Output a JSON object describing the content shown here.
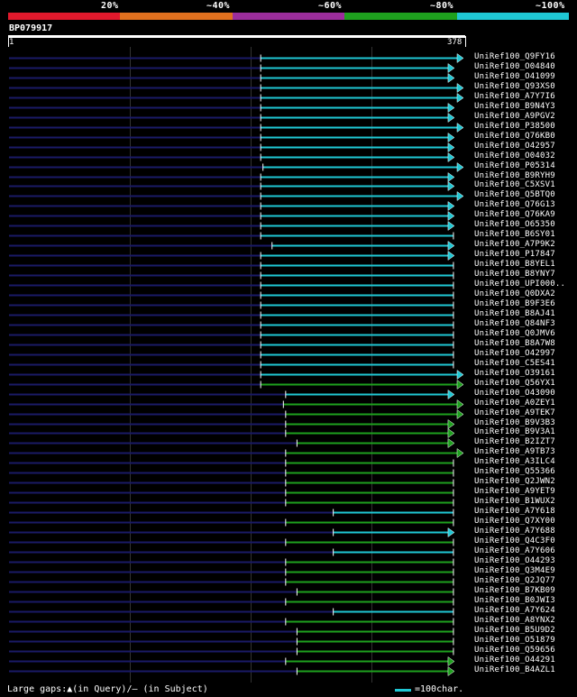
{
  "legend": {
    "labels": [
      "20%",
      "~40%",
      "~60%",
      "~80%",
      "~100%"
    ],
    "colors": [
      "#e0192c",
      "#e0701e",
      "#9b2d9b",
      "#1ea01e",
      "#1fc7d4"
    ]
  },
  "query": {
    "name": "BP079917",
    "start": "1",
    "end": "378"
  },
  "colors": {
    "cyan": "#1fc7d4",
    "green": "#1ea01e",
    "dashed": "#1a1a66",
    "background": "#000000"
  },
  "hits": [
    {
      "label": "UniRef100_Q9FY16",
      "start": 0.555,
      "end": 1.0,
      "arrow": true,
      "color": "cyan"
    },
    {
      "label": "UniRef100_O04840",
      "start": 0.555,
      "end": 0.98,
      "arrow": true,
      "color": "cyan"
    },
    {
      "label": "UniRef100_O41099",
      "start": 0.555,
      "end": 0.98,
      "arrow": true,
      "color": "cyan"
    },
    {
      "label": "UniRef100_Q93XS0",
      "start": 0.555,
      "end": 1.0,
      "arrow": true,
      "color": "cyan"
    },
    {
      "label": "UniRef100_A7Y7I6",
      "start": 0.555,
      "end": 1.0,
      "arrow": true,
      "color": "cyan"
    },
    {
      "label": "UniRef100_B9N4Y3",
      "start": 0.555,
      "end": 0.98,
      "arrow": true,
      "color": "cyan"
    },
    {
      "label": "UniRef100_A9PGV2",
      "start": 0.555,
      "end": 0.98,
      "arrow": true,
      "color": "cyan"
    },
    {
      "label": "UniRef100_P38500",
      "start": 0.555,
      "end": 1.0,
      "arrow": true,
      "color": "cyan"
    },
    {
      "label": "UniRef100_Q76KB0",
      "start": 0.555,
      "end": 0.98,
      "arrow": true,
      "color": "cyan"
    },
    {
      "label": "UniRef100_O42957",
      "start": 0.555,
      "end": 0.98,
      "arrow": true,
      "color": "cyan"
    },
    {
      "label": "UniRef100_O04032",
      "start": 0.555,
      "end": 0.98,
      "arrow": true,
      "color": "cyan"
    },
    {
      "label": "UniRef100_P05314",
      "start": 0.56,
      "end": 1.0,
      "arrow": true,
      "color": "cyan"
    },
    {
      "label": "UniRef100_B9RYH9",
      "start": 0.555,
      "end": 0.98,
      "arrow": true,
      "color": "cyan"
    },
    {
      "label": "UniRef100_C5XSV1",
      "start": 0.555,
      "end": 0.98,
      "arrow": true,
      "color": "cyan"
    },
    {
      "label": "UniRef100_Q5BTQ0",
      "start": 0.555,
      "end": 1.0,
      "arrow": true,
      "color": "cyan"
    },
    {
      "label": "UniRef100_Q76G13",
      "start": 0.555,
      "end": 0.98,
      "arrow": true,
      "color": "cyan"
    },
    {
      "label": "UniRef100_Q76KA9",
      "start": 0.555,
      "end": 0.98,
      "arrow": true,
      "color": "cyan"
    },
    {
      "label": "UniRef100_O65350",
      "start": 0.555,
      "end": 0.98,
      "arrow": true,
      "color": "cyan"
    },
    {
      "label": "UniRef100_B6SY01",
      "start": 0.555,
      "end": 0.98,
      "arrow": false,
      "color": "cyan"
    },
    {
      "label": "UniRef100_A7P9K2",
      "start": 0.58,
      "end": 0.98,
      "arrow": true,
      "color": "cyan"
    },
    {
      "label": "UniRef100_P17847",
      "start": 0.555,
      "end": 0.98,
      "arrow": true,
      "color": "cyan"
    },
    {
      "label": "UniRef100_B8YEL1",
      "start": 0.555,
      "end": 0.98,
      "arrow": false,
      "color": "cyan"
    },
    {
      "label": "UniRef100_B8YNY7",
      "start": 0.555,
      "end": 0.98,
      "arrow": false,
      "color": "cyan"
    },
    {
      "label": "UniRef100_UPI000..",
      "start": 0.555,
      "end": 0.98,
      "arrow": false,
      "color": "cyan"
    },
    {
      "label": "UniRef100_Q0DXA2",
      "start": 0.555,
      "end": 0.98,
      "arrow": false,
      "color": "cyan"
    },
    {
      "label": "UniRef100_B9F3E6",
      "start": 0.555,
      "end": 0.98,
      "arrow": false,
      "color": "cyan"
    },
    {
      "label": "UniRef100_B8AJ41",
      "start": 0.555,
      "end": 0.98,
      "arrow": false,
      "color": "cyan"
    },
    {
      "label": "UniRef100_Q84NF3",
      "start": 0.555,
      "end": 0.98,
      "arrow": false,
      "color": "cyan"
    },
    {
      "label": "UniRef100_Q0JMV6",
      "start": 0.555,
      "end": 0.98,
      "arrow": false,
      "color": "cyan"
    },
    {
      "label": "UniRef100_B8A7W8",
      "start": 0.555,
      "end": 0.98,
      "arrow": false,
      "color": "cyan"
    },
    {
      "label": "UniRef100_O42997",
      "start": 0.555,
      "end": 0.98,
      "arrow": false,
      "color": "cyan"
    },
    {
      "label": "UniRef100_C5ES41",
      "start": 0.555,
      "end": 0.98,
      "arrow": false,
      "color": "cyan"
    },
    {
      "label": "UniRef100_O39161",
      "start": 0.555,
      "end": 1.0,
      "arrow": true,
      "color": "cyan"
    },
    {
      "label": "UniRef100_Q56YX1",
      "start": 0.555,
      "end": 1.0,
      "arrow": true,
      "color": "green"
    },
    {
      "label": "UniRef100_O43090",
      "start": 0.61,
      "end": 0.98,
      "arrow": true,
      "color": "cyan"
    },
    {
      "label": "UniRef100_A0ZEY1",
      "start": 0.605,
      "end": 1.0,
      "arrow": true,
      "color": "green"
    },
    {
      "label": "UniRef100_A9TEK7",
      "start": 0.61,
      "end": 1.0,
      "arrow": true,
      "color": "green"
    },
    {
      "label": "UniRef100_B9V3B3",
      "start": 0.61,
      "end": 0.98,
      "arrow": true,
      "color": "green"
    },
    {
      "label": "UniRef100_B9V3A1",
      "start": 0.61,
      "end": 0.98,
      "arrow": true,
      "color": "green"
    },
    {
      "label": "UniRef100_B2IZT7",
      "start": 0.635,
      "end": 0.98,
      "arrow": true,
      "color": "green"
    },
    {
      "label": "UniRef100_A9TB73",
      "start": 0.61,
      "end": 1.0,
      "arrow": true,
      "color": "green"
    },
    {
      "label": "UniRef100_A3ILC4",
      "start": 0.61,
      "end": 0.98,
      "arrow": false,
      "color": "green"
    },
    {
      "label": "UniRef100_Q55366",
      "start": 0.61,
      "end": 0.98,
      "arrow": false,
      "color": "green"
    },
    {
      "label": "UniRef100_Q2JWN2",
      "start": 0.61,
      "end": 0.98,
      "arrow": false,
      "color": "green"
    },
    {
      "label": "UniRef100_A9YET9",
      "start": 0.61,
      "end": 0.98,
      "arrow": false,
      "color": "green"
    },
    {
      "label": "UniRef100_B1WUX2",
      "start": 0.61,
      "end": 0.98,
      "arrow": false,
      "color": "green"
    },
    {
      "label": "UniRef100_A7Y618",
      "start": 0.715,
      "end": 0.98,
      "arrow": false,
      "color": "cyan"
    },
    {
      "label": "UniRef100_Q7XY00",
      "start": 0.61,
      "end": 0.98,
      "arrow": false,
      "color": "green"
    },
    {
      "label": "UniRef100_A7Y688",
      "start": 0.715,
      "end": 0.98,
      "arrow": true,
      "color": "cyan"
    },
    {
      "label": "UniRef100_Q4C3F0",
      "start": 0.61,
      "end": 0.98,
      "arrow": false,
      "color": "green"
    },
    {
      "label": "UniRef100_A7Y606",
      "start": 0.715,
      "end": 0.98,
      "arrow": false,
      "color": "cyan"
    },
    {
      "label": "UniRef100_O44293",
      "start": 0.61,
      "end": 0.98,
      "arrow": false,
      "color": "green"
    },
    {
      "label": "UniRef100_Q3M4E9",
      "start": 0.61,
      "end": 0.98,
      "arrow": false,
      "color": "green"
    },
    {
      "label": "UniRef100_Q2JQ77",
      "start": 0.61,
      "end": 0.98,
      "arrow": false,
      "color": "green"
    },
    {
      "label": "UniRef100_B7KB09",
      "start": 0.635,
      "end": 0.98,
      "arrow": false,
      "color": "green"
    },
    {
      "label": "UniRef100_B0JWI3",
      "start": 0.61,
      "end": 0.98,
      "arrow": false,
      "color": "green"
    },
    {
      "label": "UniRef100_A7Y624",
      "start": 0.715,
      "end": 0.98,
      "arrow": false,
      "color": "cyan"
    },
    {
      "label": "UniRef100_A8YNX2",
      "start": 0.61,
      "end": 0.98,
      "arrow": false,
      "color": "green"
    },
    {
      "label": "UniRef100_B5U9D2",
      "start": 0.635,
      "end": 0.98,
      "arrow": false,
      "color": "green"
    },
    {
      "label": "UniRef100_O51879",
      "start": 0.635,
      "end": 0.98,
      "arrow": false,
      "color": "green"
    },
    {
      "label": "UniRef100_Q59656",
      "start": 0.635,
      "end": 0.98,
      "arrow": false,
      "color": "green"
    },
    {
      "label": "UniRef100_O44291",
      "start": 0.61,
      "end": 0.98,
      "arrow": true,
      "color": "green"
    },
    {
      "label": "UniRef100_B4AZL1",
      "start": 0.635,
      "end": 0.98,
      "arrow": true,
      "color": "green"
    }
  ],
  "footer": {
    "gaps_text": "Large gaps:▲(in Query)/– (in Subject)",
    "scale_text": "=100char."
  }
}
